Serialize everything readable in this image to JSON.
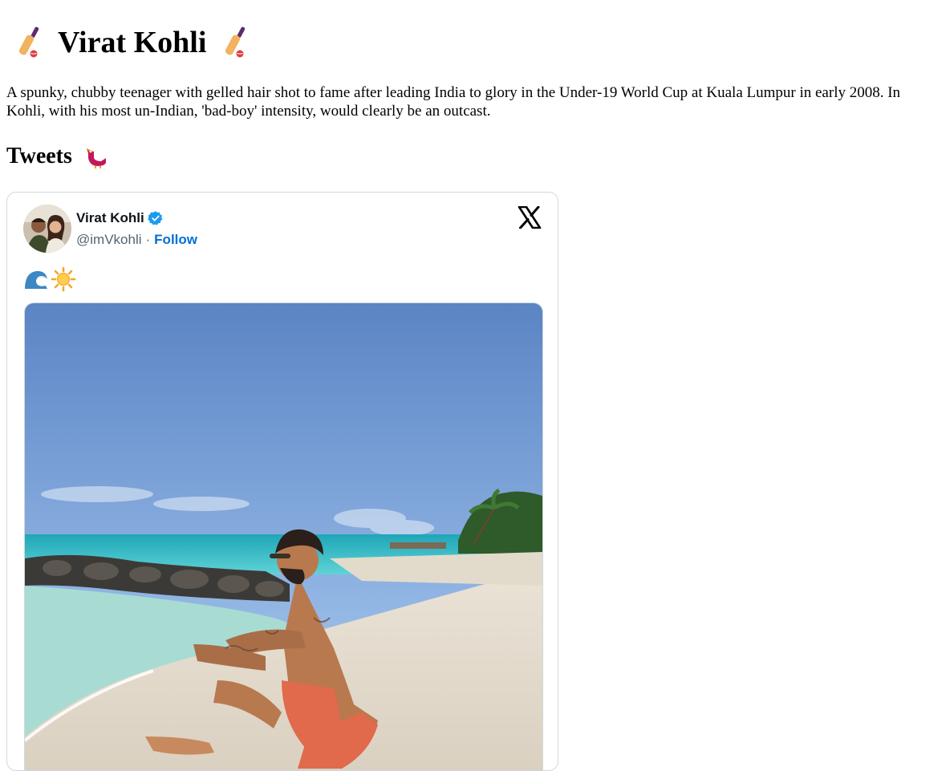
{
  "page": {
    "title": "Virat Kohli",
    "title_icon": "cricket-bat-icon",
    "intro_line_1": "A spunky, chubby teenager with gelled hair shot to fame after leading India to glory in the Under-19 World Cup at Kuala Lumpur in early 2008. In",
    "intro_line_2": "Kohli, with his most un-Indian, 'bad-boy' intensity, would clearly be an outcast.",
    "tweets_heading": "Tweets",
    "tweets_icon": "bird-icon"
  },
  "tweet": {
    "author_name": "Virat Kohli",
    "verified": true,
    "handle": "@imVkohli",
    "separator": "·",
    "follow_label": "Follow",
    "platform_icon": "x-logo-icon",
    "text_emoji": [
      "wave-icon",
      "sun-icon"
    ],
    "media": "beach-photo"
  },
  "colors": {
    "link": "#006fd6",
    "handle": "#536471",
    "verified": "#1d9bf0",
    "border": "#cfd9de"
  }
}
